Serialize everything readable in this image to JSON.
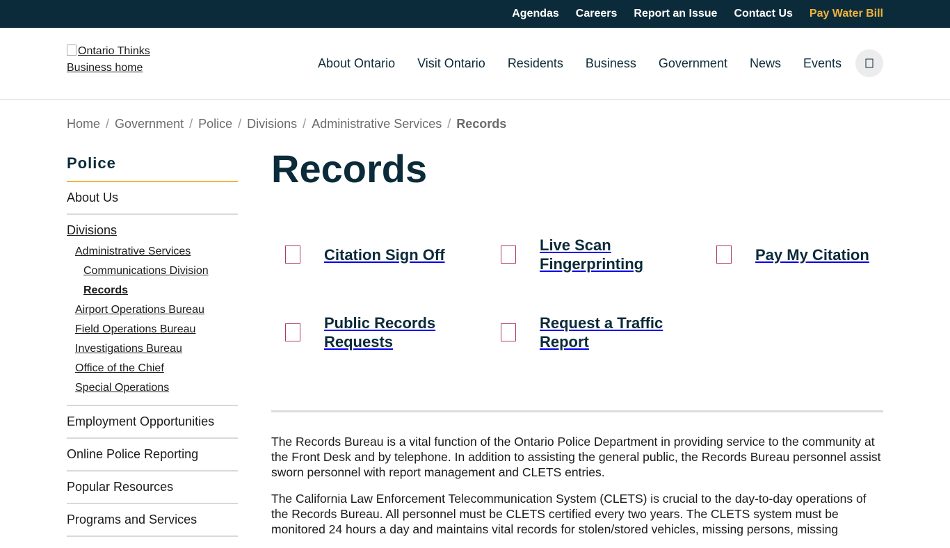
{
  "utility": {
    "links": [
      "Agendas",
      "Careers",
      "Report an Issue",
      "Contact Us"
    ],
    "pay_link": "Pay Water Bill",
    "accent_color": "#f0b43c",
    "bar_color": "#0c2b3a"
  },
  "header": {
    "logo_alt": "Ontario Thinks Business home",
    "nav": [
      "About Ontario",
      "Visit Ontario",
      "Residents",
      "Business",
      "Government",
      "News",
      "Events"
    ],
    "search_icon": "search-icon"
  },
  "breadcrumb": {
    "items": [
      "Home",
      "Government",
      "Police",
      "Divisions",
      "Administrative Services"
    ],
    "current": "Records",
    "separator": "/"
  },
  "sidebar": {
    "title": "Police",
    "about": "About Us",
    "divisions": "Divisions",
    "admin": "Administrative Services",
    "comms": "Communications Division",
    "records": "Records",
    "subs": [
      "Airport Operations Bureau",
      "Field Operations Bureau",
      "Investigations Bureau",
      "Office of the Chief",
      "Special Operations"
    ],
    "bottom": [
      "Employment Opportunities",
      "Online Police Reporting",
      "Popular Resources",
      "Programs and Services"
    ]
  },
  "main": {
    "title": "Records",
    "quick_links": [
      "Citation Sign Off",
      "Live Scan Fingerprinting",
      "Pay My Citation",
      "Public Records Requests",
      "Request a Traffic Report"
    ],
    "paragraphs": [
      "The Records Bureau is a vital function of the Ontario Police Department in providing service to the community at the Front Desk and by telephone. In addition to assisting the general public, the Records Bureau personnel assist sworn personnel with report management and CLETS entries.",
      "The California Law Enforcement Telecommunication System (CLETS) is crucial to the day-to-day operations of the Records Bureau. All personnel must be CLETS certified every two years. The CLETS system must be monitored 24 hours a day and maintains vital records for stolen/stored vehicles, missing persons, missing"
    ]
  }
}
